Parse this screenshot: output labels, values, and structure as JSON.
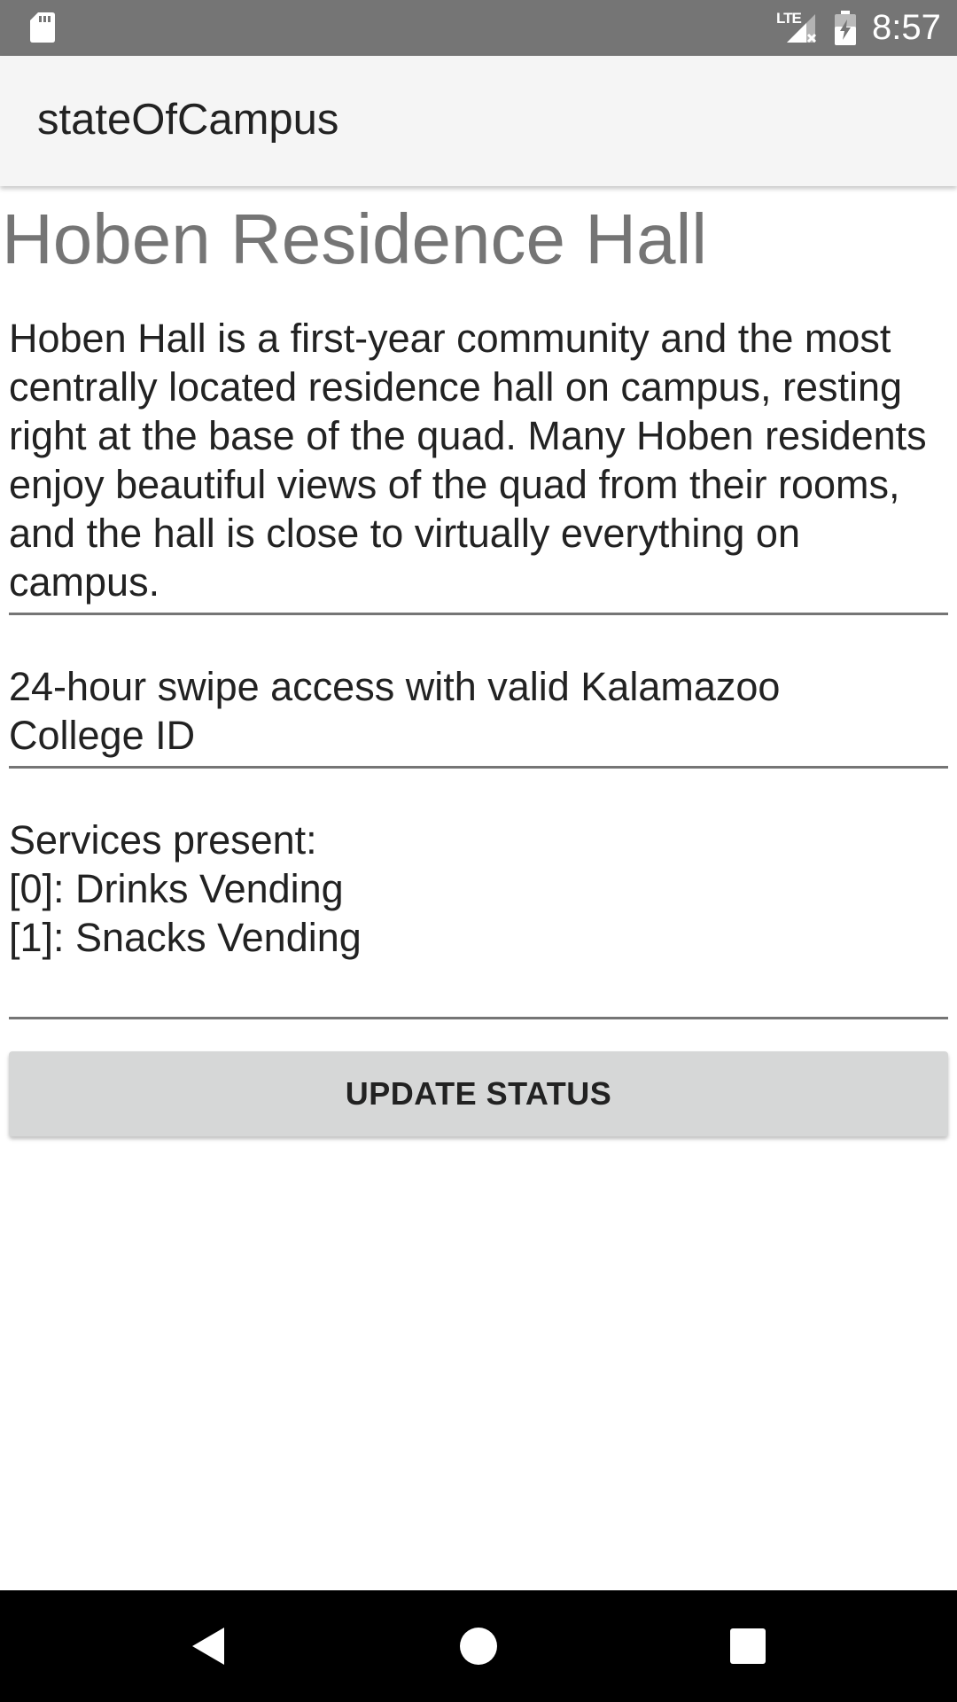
{
  "status_bar": {
    "network": "LTE",
    "time": "8:57",
    "icons": [
      "sd-card-icon",
      "signal-icon",
      "battery-charging-icon"
    ]
  },
  "app_bar": {
    "title": "stateOfCampus"
  },
  "hall": {
    "name": "Hoben Residence Hall",
    "description": "Hoben Hall is a first-year community and the most centrally located residence hall on campus, resting right at the base of the quad. Many Hoben residents enjoy beautiful views of the quad from their rooms, and the hall is close to virtually everything on campus.",
    "access_line1": "24-hour swipe access with valid Kalamazoo",
    "access_line2": "College ID",
    "services_heading": "Services present:",
    "services": [
      "[0]: Drinks Vending",
      "[1]: Snacks Vending"
    ]
  },
  "actions": {
    "update_label": "UPDATE STATUS"
  },
  "nav_bar": {
    "icons": [
      "back-icon",
      "home-icon",
      "recents-icon"
    ]
  },
  "colors": {
    "status_bar": "#757575",
    "app_bar": "#f5f5f5",
    "title_gray": "#757575",
    "button": "#d6d7d7",
    "nav_bar": "#000000"
  }
}
